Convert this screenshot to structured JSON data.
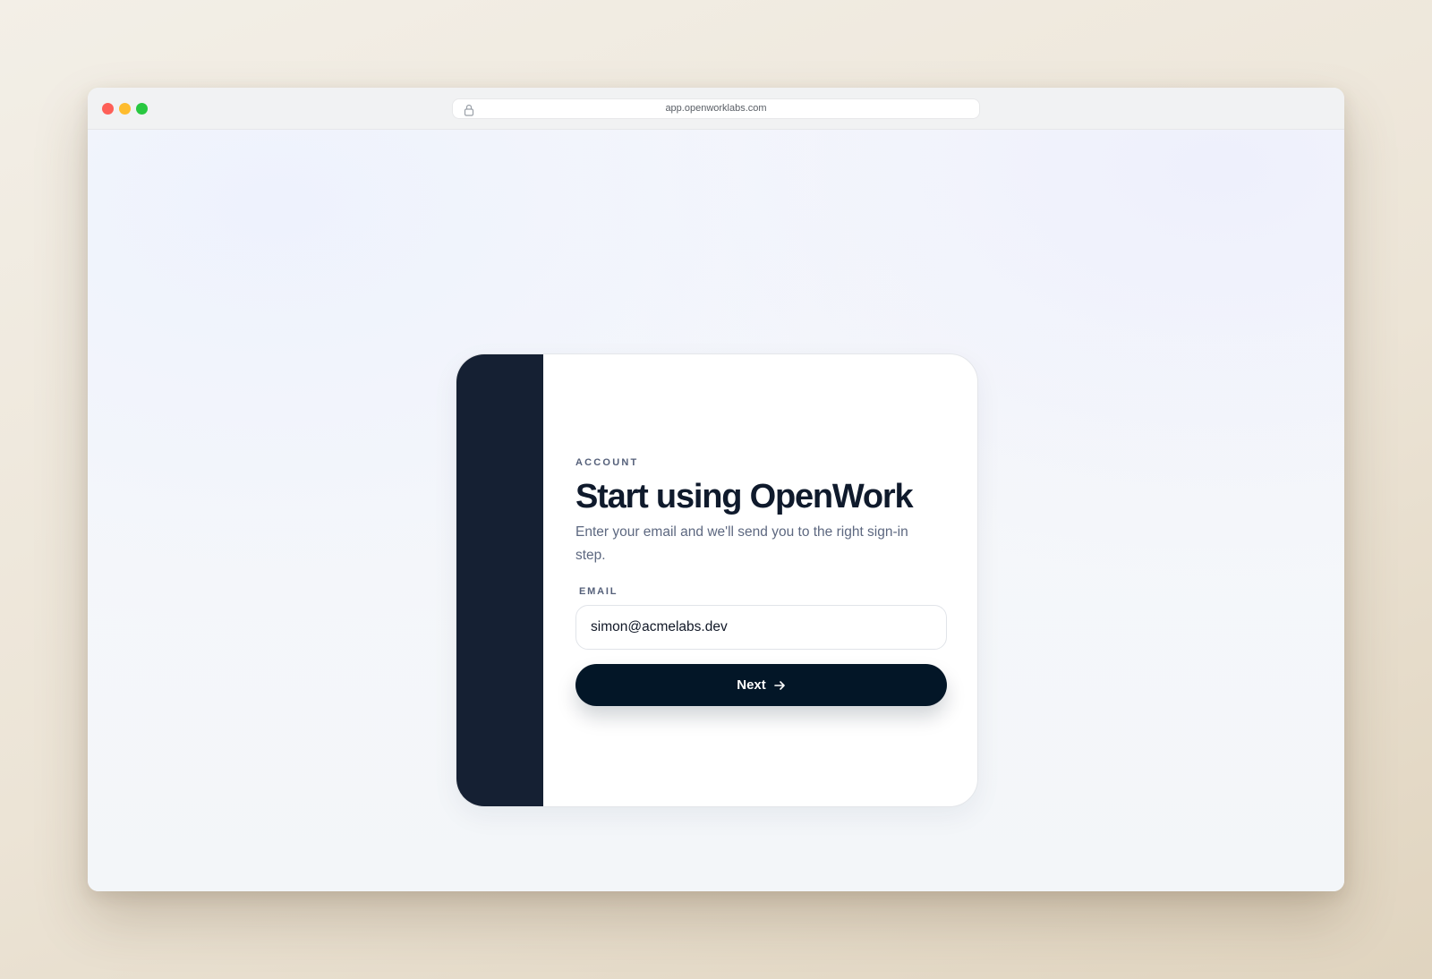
{
  "browser": {
    "url": "app.openworklabs.com"
  },
  "card": {
    "eyebrow": "ACCOUNT",
    "title": "Start using OpenWork",
    "subtitle": "Enter your email and we'll send you to the right sign-in step.",
    "email": {
      "label": "EMAIL",
      "value": "simon@acmelabs.dev"
    },
    "next_label": "Next"
  },
  "colors": {
    "side_panel": "#152033",
    "button": "#031627",
    "title": "#0f1a2c",
    "muted": "#5d6880"
  },
  "icons": {
    "lock": "lock-icon",
    "arrow": "arrow-right-icon"
  }
}
